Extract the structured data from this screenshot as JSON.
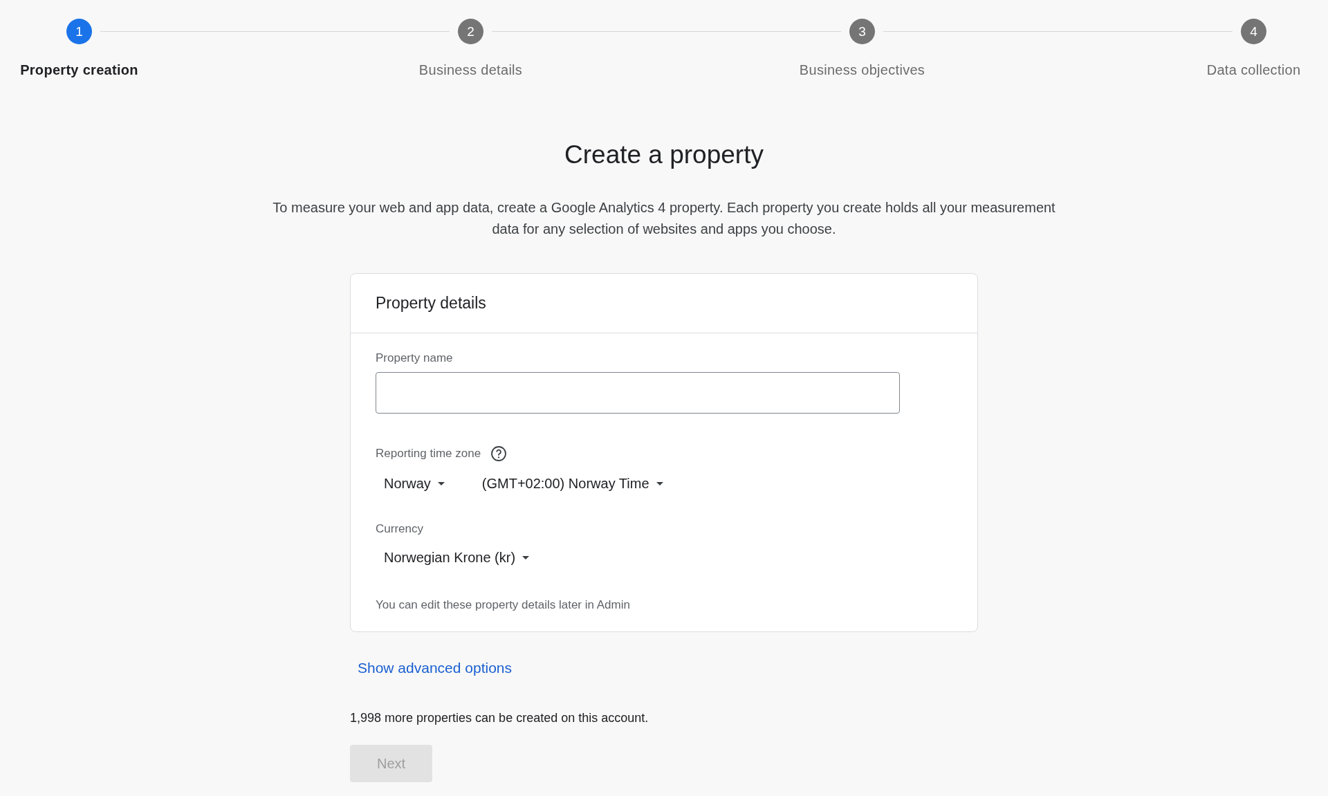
{
  "steps": [
    {
      "number": "1",
      "label": "Property creation",
      "selected": true
    },
    {
      "number": "2",
      "label": "Business details",
      "selected": false
    },
    {
      "number": "3",
      "label": "Business objectives",
      "selected": false
    },
    {
      "number": "4",
      "label": "Data collection",
      "selected": false
    }
  ],
  "heading": "Create a property",
  "intro": "To measure your web and app data, create a Google Analytics 4 property. Each property you create holds all your measurement data for any selection of websites and apps you choose.",
  "card": {
    "title": "Property details",
    "property_name": {
      "label": "Property name"
    },
    "time_zone": {
      "label": "Reporting time zone",
      "country": "Norway",
      "zone": "(GMT+02:00) Norway Time"
    },
    "currency": {
      "label": "Currency",
      "value": "Norwegian Krone (kr)"
    },
    "note": "You can edit these property details later in Admin"
  },
  "advanced_link": "Show advanced options",
  "quota_text": "1,998 more properties can be created on this account.",
  "next_button": {
    "label": "Next",
    "disabled": true
  }
}
